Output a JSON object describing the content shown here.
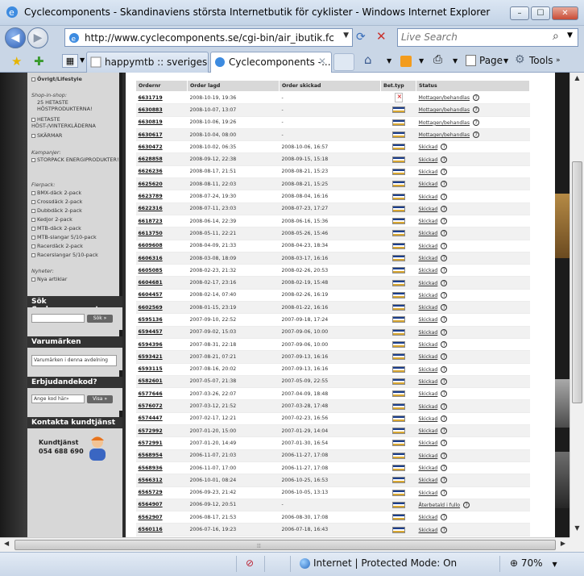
{
  "window": {
    "title": "Cyclecomponents - Skandinaviens största Internetbutik för cyklister - Windows Internet Explorer",
    "min_label": "–",
    "max_label": "☐",
    "close_label": "✕"
  },
  "navbar": {
    "url": "http://www.cyclecomponents.se/cgi-bin/air_ibutik.fcgi?avd=8",
    "search_placeholder": "Live Search"
  },
  "tabs": [
    {
      "label": "happymtb :: sveriges tr..."
    },
    {
      "label": "Cyclecomponents -..."
    }
  ],
  "commands": {
    "page": "Page",
    "tools": "Tools"
  },
  "sidebar": {
    "top_item": "Övrigt/Lifestyle",
    "shop_in_shop_heading": "Shop-in-shop:",
    "shop_in_shop": [
      "25 HETASTE HÖSTPRODUKTERNA!",
      "HETASTE HÖST-/VINTERKLÄDERNA",
      "SKÄRMAR"
    ],
    "kampanjer_heading": "Kampanjer:",
    "kampanjer": [
      "STORPACK ENERGIPRODUKTER!"
    ],
    "flerpack_heading": "Flerpack:",
    "flerpack": [
      "BMX-däck 2-pack",
      "Crossdäck 2-pack",
      "Dubbdäck 2-pack",
      "Kedjor 2-pack",
      "MTB-däck 2-pack",
      "MTB-slangar 5/10-pack",
      "Racerdäck 2-pack",
      "Racerslangar 5/10-pack"
    ],
    "nyheter_heading": "Nyheter:",
    "nyheter": [
      "Nya artiklar"
    ],
    "search_title": "Sök Cyclecomponents",
    "search_button": "Sök »",
    "brands_title": "Varumärken",
    "brands_select": "Varumärken i denna avdelning",
    "discount_title": "Erbjudandekod?",
    "discount_placeholder": "Ange kod här»",
    "discount_button": "Visa »",
    "contact_title": "Kontakta kundtjänst",
    "contact_label": "Kundtjänst",
    "contact_phone": "054 688 690"
  },
  "orders": {
    "columns": [
      "Ordernr",
      "Order lagd",
      "Order skickad",
      "Bet.typ",
      "Status"
    ],
    "rows": [
      {
        "nr": "6631719",
        "placed": "2008-10-19, 19:36",
        "sent": "-",
        "pay": "pending",
        "status": "Mottagen/behandlas"
      },
      {
        "nr": "6630883",
        "placed": "2008-10-07, 13:07",
        "sent": "-",
        "pay": "visa",
        "status": "Mottagen/behandlas"
      },
      {
        "nr": "6630819",
        "placed": "2008-10-06, 19:26",
        "sent": "-",
        "pay": "visa",
        "status": "Mottagen/behandlas"
      },
      {
        "nr": "6630617",
        "placed": "2008-10-04, 08:00",
        "sent": "-",
        "pay": "visa",
        "status": "Mottagen/behandlas"
      },
      {
        "nr": "6630472",
        "placed": "2008-10-02, 06:35",
        "sent": "2008-10-06, 16:57",
        "pay": "visa",
        "status": "Skickad"
      },
      {
        "nr": "6628858",
        "placed": "2008-09-12, 22:38",
        "sent": "2008-09-15, 15:18",
        "pay": "visa",
        "status": "Skickad"
      },
      {
        "nr": "6626236",
        "placed": "2008-08-17, 21:51",
        "sent": "2008-08-21, 15:23",
        "pay": "visa",
        "status": "Skickad"
      },
      {
        "nr": "6625620",
        "placed": "2008-08-11, 22:03",
        "sent": "2008-08-21, 15:25",
        "pay": "visa",
        "status": "Skickad"
      },
      {
        "nr": "6623789",
        "placed": "2008-07-24, 19:30",
        "sent": "2008-08-04, 16:16",
        "pay": "visa",
        "status": "Skickad"
      },
      {
        "nr": "6622316",
        "placed": "2008-07-11, 23:03",
        "sent": "2008-07-23, 17:27",
        "pay": "visa",
        "status": "Skickad"
      },
      {
        "nr": "6618723",
        "placed": "2008-06-14, 22:39",
        "sent": "2008-06-16, 15:36",
        "pay": "visa",
        "status": "Skickad"
      },
      {
        "nr": "6613750",
        "placed": "2008-05-11, 22:21",
        "sent": "2008-05-26, 15:46",
        "pay": "visa",
        "status": "Skickad"
      },
      {
        "nr": "6609608",
        "placed": "2008-04-09, 21:33",
        "sent": "2008-04-23, 18:34",
        "pay": "visa",
        "status": "Skickad"
      },
      {
        "nr": "6606316",
        "placed": "2008-03-08, 18:09",
        "sent": "2008-03-17, 16:16",
        "pay": "visa",
        "status": "Skickad"
      },
      {
        "nr": "6605085",
        "placed": "2008-02-23, 21:32",
        "sent": "2008-02-26, 20:53",
        "pay": "visa",
        "status": "Skickad"
      },
      {
        "nr": "6604681",
        "placed": "2008-02-17, 23:16",
        "sent": "2008-02-19, 15:48",
        "pay": "visa",
        "status": "Skickad"
      },
      {
        "nr": "6604457",
        "placed": "2008-02-14, 07:40",
        "sent": "2008-02-26, 16:19",
        "pay": "visa",
        "status": "Skickad"
      },
      {
        "nr": "6602569",
        "placed": "2008-01-15, 23:19",
        "sent": "2008-01-22, 16:16",
        "pay": "visa",
        "status": "Skickad"
      },
      {
        "nr": "6595136",
        "placed": "2007-09-10, 22:52",
        "sent": "2007-09-18, 17:24",
        "pay": "visa",
        "status": "Skickad"
      },
      {
        "nr": "6594457",
        "placed": "2007-09-02, 15:03",
        "sent": "2007-09-06, 10:00",
        "pay": "visa",
        "status": "Skickad"
      },
      {
        "nr": "6594396",
        "placed": "2007-08-31, 22:18",
        "sent": "2007-09-06, 10:00",
        "pay": "visa",
        "status": "Skickad"
      },
      {
        "nr": "6593421",
        "placed": "2007-08-21, 07:21",
        "sent": "2007-09-13, 16:16",
        "pay": "visa",
        "status": "Skickad"
      },
      {
        "nr": "6593115",
        "placed": "2007-08-16, 20:02",
        "sent": "2007-09-13, 16:16",
        "pay": "visa",
        "status": "Skickad"
      },
      {
        "nr": "6582601",
        "placed": "2007-05-07, 21:38",
        "sent": "2007-05-09, 22:55",
        "pay": "visa",
        "status": "Skickad"
      },
      {
        "nr": "6577646",
        "placed": "2007-03-26, 22:07",
        "sent": "2007-04-09, 18:48",
        "pay": "visa",
        "status": "Skickad"
      },
      {
        "nr": "6576072",
        "placed": "2007-03-12, 21:52",
        "sent": "2007-03-28, 17:48",
        "pay": "visa",
        "status": "Skickad"
      },
      {
        "nr": "6574447",
        "placed": "2007-02-17, 12:21",
        "sent": "2007-02-23, 16:56",
        "pay": "visa",
        "status": "Skickad"
      },
      {
        "nr": "6572992",
        "placed": "2007-01-20, 15:00",
        "sent": "2007-01-29, 14:04",
        "pay": "visa",
        "status": "Skickad"
      },
      {
        "nr": "6572991",
        "placed": "2007-01-20, 14:49",
        "sent": "2007-01-30, 16:54",
        "pay": "visa",
        "status": "Skickad"
      },
      {
        "nr": "6568954",
        "placed": "2006-11-07, 21:03",
        "sent": "2006-11-27, 17:08",
        "pay": "visa",
        "status": "Skickad"
      },
      {
        "nr": "6568936",
        "placed": "2006-11-07, 17:00",
        "sent": "2006-11-27, 17:08",
        "pay": "visa",
        "status": "Skickad"
      },
      {
        "nr": "6566312",
        "placed": "2006-10-01, 08:24",
        "sent": "2006-10-25, 16:53",
        "pay": "visa",
        "status": "Skickad"
      },
      {
        "nr": "6565729",
        "placed": "2006-09-23, 21:42",
        "sent": "2006-10-05, 13:13",
        "pay": "visa",
        "status": "Skickad"
      },
      {
        "nr": "6564907",
        "placed": "2006-09-12, 20:51",
        "sent": "-",
        "pay": "visa",
        "status": "Återbetald i fullo"
      },
      {
        "nr": "6562907",
        "placed": "2006-08-17, 21:53",
        "sent": "2006-08-30, 17:08",
        "pay": "visa",
        "status": "Skickad"
      },
      {
        "nr": "6560116",
        "placed": "2006-07-16, 19:23",
        "sent": "2006-07-18, 16:43",
        "pay": "visa",
        "status": "Skickad"
      }
    ]
  },
  "statusbar": {
    "zone": "Internet | Protected Mode: On",
    "zoom": "70%"
  }
}
